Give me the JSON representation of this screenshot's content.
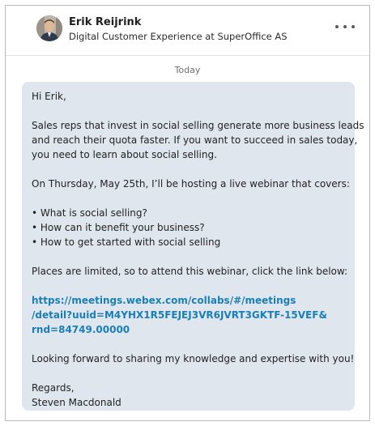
{
  "sender": {
    "name": "Erik Reijrink",
    "headline": "Digital Customer Experience at SuperOffice AS",
    "avatar_icon": "profile-photo"
  },
  "more_icon": "ellipsis-icon",
  "date_label": "Today",
  "message": {
    "greeting": "Hi Erik,",
    "p1_line1": "Sales reps that invest in social selling generate more business leads",
    "p1_line2": "and reach their quota faster. If you want to succeed in sales today,",
    "p1_line3": "you need to learn about social selling.",
    "p2_line1": "On Thursday, May 25th, I’ll be hosting a live webinar that covers:",
    "bullets": [
      "• What is social selling?",
      "• How can it benefit your business?",
      "• How to get started with social selling"
    ],
    "p3_line1": "Places are limited, so to attend this webinar, click the link below:",
    "link_lines": [
      "https://meetings.webex.com/collabs/#/meetings",
      "/detail?uuid=M4YHX1R5FEJEJ3VR6JVRT3GKTF-15VEF&",
      "rnd=84749.00000"
    ],
    "p4_line1": "Looking forward to sharing my knowledge and expertise with you!",
    "signoff": "Regards,",
    "signature": "Steven Macdonald"
  },
  "colors": {
    "bubble": "#dfe6ee",
    "link": "#1a7fb5"
  }
}
